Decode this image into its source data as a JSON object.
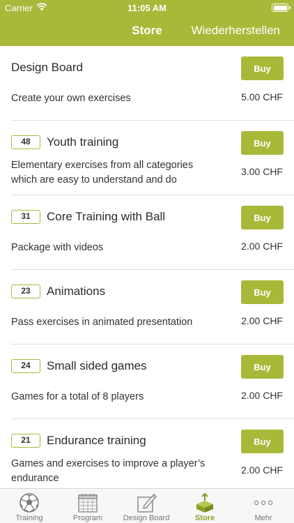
{
  "status": {
    "carrier": "Carrier",
    "time": "11:05 AM"
  },
  "nav": {
    "title": "Store",
    "restore": "Wiederherstellen"
  },
  "buy_label": "Buy",
  "items": [
    {
      "badge": "",
      "title": "Design Board",
      "description": "Create your own exercises",
      "price": "5.00 CHF"
    },
    {
      "badge": "48",
      "title": "Youth training",
      "description": "Elementary exercises from all categories which are easy to understand and do",
      "price": "3.00 CHF"
    },
    {
      "badge": "31",
      "title": "Core Training with Ball",
      "description": "Package with videos",
      "price": "2.00 CHF"
    },
    {
      "badge": "23",
      "title": "Animations",
      "description": "Pass exercises in animated presentation",
      "price": "2.00 CHF"
    },
    {
      "badge": "24",
      "title": "Small sided games",
      "description": "Games for a total of 8 players",
      "price": "2.00 CHF"
    },
    {
      "badge": "21",
      "title": "Endurance training",
      "description": "Games and exercises to improve a player’s endurance",
      "price": "2.00 CHF"
    }
  ],
  "tabs": [
    {
      "label": "Training",
      "icon": "soccer-ball-icon"
    },
    {
      "label": "Program",
      "icon": "calendar-icon"
    },
    {
      "label": "Design Board",
      "icon": "board-pencil-icon"
    },
    {
      "label": "Store",
      "icon": "box-icon",
      "active": true
    },
    {
      "label": "Mehr",
      "icon": "more-dots-icon"
    }
  ],
  "colors": {
    "accent": "#a8b93a",
    "accent_text": "#8fa02a"
  }
}
